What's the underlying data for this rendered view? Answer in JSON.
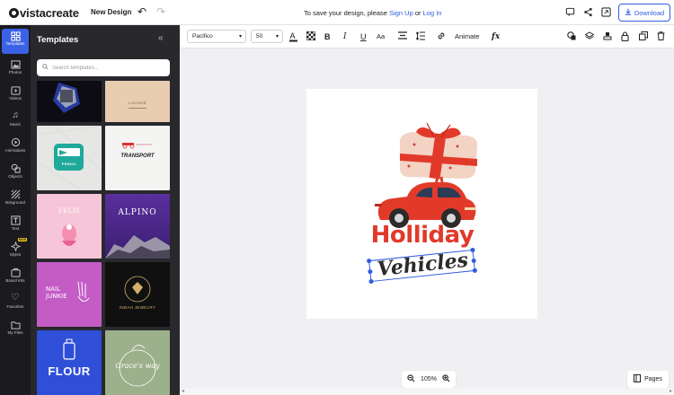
{
  "topbar": {
    "logo_text": "vistacreate",
    "new_design_label": "New Design",
    "save_message_prefix": "To save your design, please ",
    "sign_up_label": "Sign Up",
    "save_message_or": " or ",
    "log_in_label": "Log In",
    "download_label": "Download"
  },
  "rail": {
    "items": [
      {
        "label": "Templates",
        "icon": "templates-icon",
        "active": true
      },
      {
        "label": "Photos",
        "icon": "photo-icon"
      },
      {
        "label": "Videos",
        "icon": "video-icon"
      },
      {
        "label": "Music",
        "icon": "music-icon"
      },
      {
        "label": "Animations",
        "icon": "animation-icon"
      },
      {
        "label": "Objects",
        "icon": "objects-icon"
      },
      {
        "label": "Bckground",
        "icon": "background-icon"
      },
      {
        "label": "Text",
        "icon": "text-icon"
      },
      {
        "label": "Styles",
        "icon": "styles-icon",
        "badge": "NEW"
      },
      {
        "label": "Brand Kits",
        "icon": "brand-kit-icon"
      },
      {
        "label": "Favorites",
        "icon": "heart-icon"
      },
      {
        "label": "My Files",
        "icon": "folder-icon"
      }
    ]
  },
  "panel": {
    "title": "Templates",
    "search_placeholder": "Search templates...",
    "templates": [
      {
        "name": "dark-partial",
        "text": ""
      },
      {
        "name": "louhor-partial",
        "text": "LOUHOR"
      },
      {
        "name": "pen-logo",
        "text": "PENCIL"
      },
      {
        "name": "transport",
        "text": "TRANSPORT"
      },
      {
        "name": "felis",
        "text": "FELIS"
      },
      {
        "name": "alpino",
        "text": "ALPINO"
      },
      {
        "name": "nail-junkie",
        "text": "NAIL JUNKIE"
      },
      {
        "name": "indah-jewelry",
        "text": "INDAH JEWELRY"
      },
      {
        "name": "flour",
        "text": "FLOUR"
      },
      {
        "name": "graces-way",
        "text": "Grace's way"
      }
    ]
  },
  "toolbar": {
    "font_family": "Pacifico",
    "font_size": "50",
    "case_label": "Aa",
    "animate_label": "Animate",
    "fx_label": "fx"
  },
  "canvas": {
    "headline": "Holliday",
    "subline": "Vehicles",
    "colors": {
      "red": "#e23a2a",
      "dark": "#2b2b2b",
      "gift": "#f2d3c4",
      "selection": "#2f5de0"
    }
  },
  "zoom": {
    "level": "105%"
  },
  "pages": {
    "label": "Pages"
  },
  "accent": "#3b62e6"
}
